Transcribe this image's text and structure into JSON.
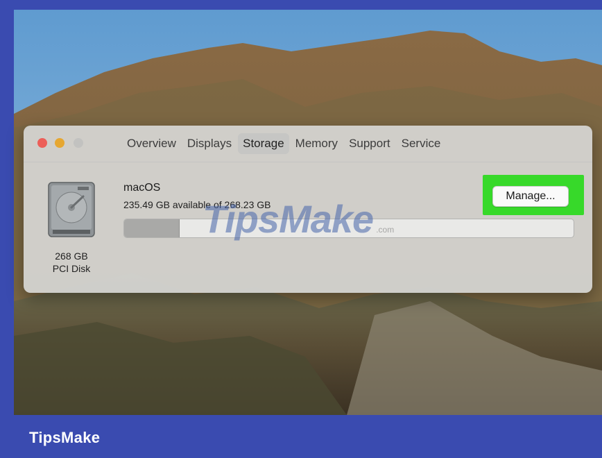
{
  "window": {
    "tabs": [
      {
        "label": "Overview",
        "active": false
      },
      {
        "label": "Displays",
        "active": false
      },
      {
        "label": "Storage",
        "active": true
      },
      {
        "label": "Memory",
        "active": false
      },
      {
        "label": "Support",
        "active": false
      },
      {
        "label": "Service",
        "active": false
      }
    ]
  },
  "disk": {
    "icon": "hard-disk-icon",
    "size": "268 GB",
    "type": "PCI Disk"
  },
  "volume": {
    "name": "macOS",
    "available_text": "235.49 GB available of 268.23 GB",
    "used_fraction": 0.1221
  },
  "manage_button": {
    "label": "Manage..."
  },
  "watermark": {
    "main": "TipsMake",
    "suffix": ".com"
  },
  "footer": {
    "brand": "TipsMake"
  },
  "colors": {
    "frame": "#3a4bb0",
    "highlight": "#37d92a",
    "close": "#ec5f58",
    "minimize": "#e6a731"
  }
}
